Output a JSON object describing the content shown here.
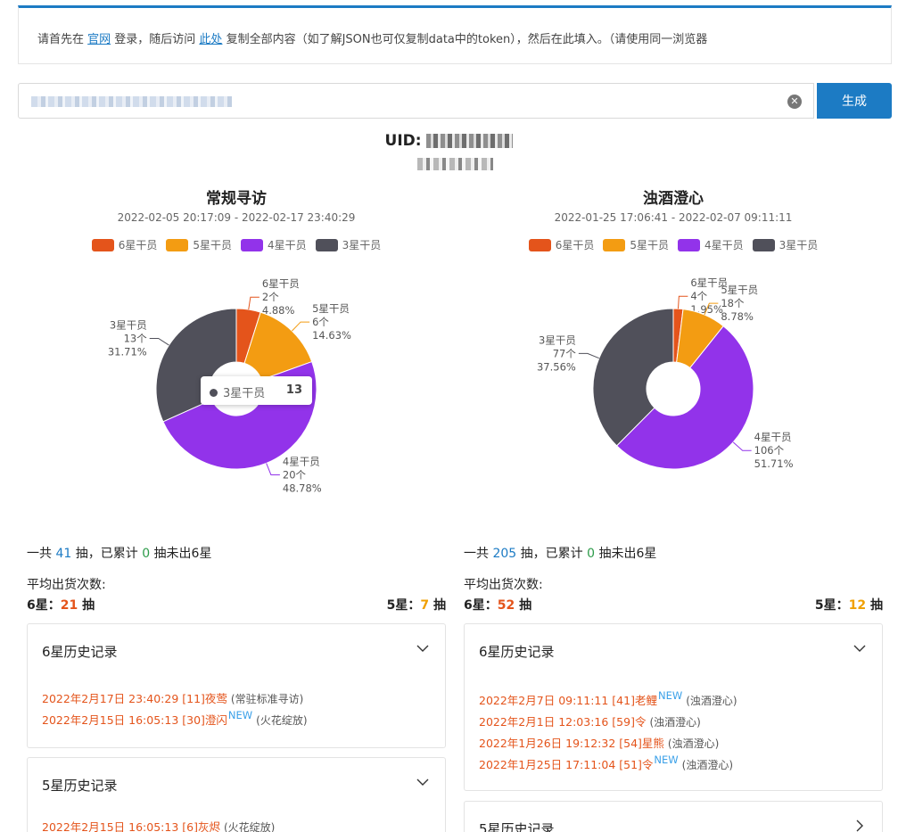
{
  "notice": {
    "prefix": "请首先在 ",
    "link1": "官网",
    "mid": " 登录，随后访问 ",
    "link2": "此处",
    "suffix": " 复制全部内容（如了解JSON也可仅复制data中的token），然后在此填入。（请使用同一浏览器"
  },
  "token_input": {
    "clear_icon": "clear-circle-icon"
  },
  "generate_label": "生成",
  "uid_label": "UID:",
  "legend_labels": [
    "6星干员",
    "5星干员",
    "4星干员",
    "3星干员"
  ],
  "colors": {
    "six": "#e4541b",
    "five": "#f39c12",
    "four": "#9233ea",
    "three": "#50505a",
    "accent": "#1c7bc4"
  },
  "pools": [
    {
      "title": "常规寻访",
      "range": "2022-02-05 20:17:09 - 2022-02-17 23:40:29",
      "summary": {
        "prefix": "一共 ",
        "total": "41",
        "mid": " 抽，已累计 ",
        "pity": "0",
        "suffix": " 抽未出6星"
      },
      "avg_label": "平均出货次数:",
      "avg": {
        "six_label": "6星：",
        "six_value": "21",
        "unit": " 抽",
        "five_label": "5星：",
        "five_value": "7"
      },
      "tooltip": {
        "label": "3星干员",
        "value": "13"
      },
      "history": {
        "six_title": "6星历史记录",
        "six_records": [
          {
            "text": "2022年2月17日 23:40:29 [11]夜莺",
            "new": "",
            "pool": "(常驻标准寻访)"
          },
          {
            "text": "2022年2月15日 16:05:13 [30]澄闪",
            "new": "NEW",
            "pool": "(火花绽放)"
          }
        ],
        "five_title": "5星历史记录",
        "five_records": [
          {
            "text": "2022年2月15日 16:05:13 [6]灰烬",
            "new": "",
            "pool": "(火花绽放)"
          }
        ]
      }
    },
    {
      "title": "浊酒澄心",
      "range": "2022-01-25 17:06:41 - 2022-02-07 09:11:11",
      "summary": {
        "prefix": "一共 ",
        "total": "205",
        "mid": " 抽，已累计 ",
        "pity": "0",
        "suffix": " 抽未出6星"
      },
      "avg_label": "平均出货次数:",
      "avg": {
        "six_label": "6星：",
        "six_value": "52",
        "unit": " 抽",
        "five_label": "5星：",
        "five_value": "12"
      },
      "tooltip": null,
      "history": {
        "six_title": "6星历史记录",
        "six_records": [
          {
            "text": "2022年2月7日 09:11:11 [41]老鲤",
            "new": "NEW",
            "pool": "(浊酒澄心)"
          },
          {
            "text": "2022年2月1日 12:03:16 [59]令",
            "new": "",
            "pool": "(浊酒澄心)"
          },
          {
            "text": "2022年1月26日 19:12:32 [54]星熊",
            "new": "",
            "pool": "(浊酒澄心)"
          },
          {
            "text": "2022年1月25日 17:11:04 [51]令",
            "new": "NEW",
            "pool": "(浊酒澄心)"
          }
        ],
        "five_title": "5星历史记录",
        "five_records": []
      }
    }
  ],
  "chart_data": [
    {
      "type": "pie",
      "title": "常规寻访",
      "categories": [
        "6星干员",
        "5星干员",
        "4星干员",
        "3星干员"
      ],
      "values": [
        2,
        6,
        20,
        13
      ],
      "percents": [
        "4.88%",
        "14.63%",
        "48.78%",
        "31.71%"
      ],
      "units": "个",
      "legend_position": "top"
    },
    {
      "type": "pie",
      "title": "浊酒澄心",
      "categories": [
        "6星干员",
        "5星干员",
        "4星干员",
        "3星干员"
      ],
      "values": [
        4,
        18,
        106,
        77
      ],
      "percents": [
        "1.95%",
        "8.78%",
        "51.71%",
        "37.56%"
      ],
      "units": "个",
      "legend_position": "top"
    }
  ]
}
